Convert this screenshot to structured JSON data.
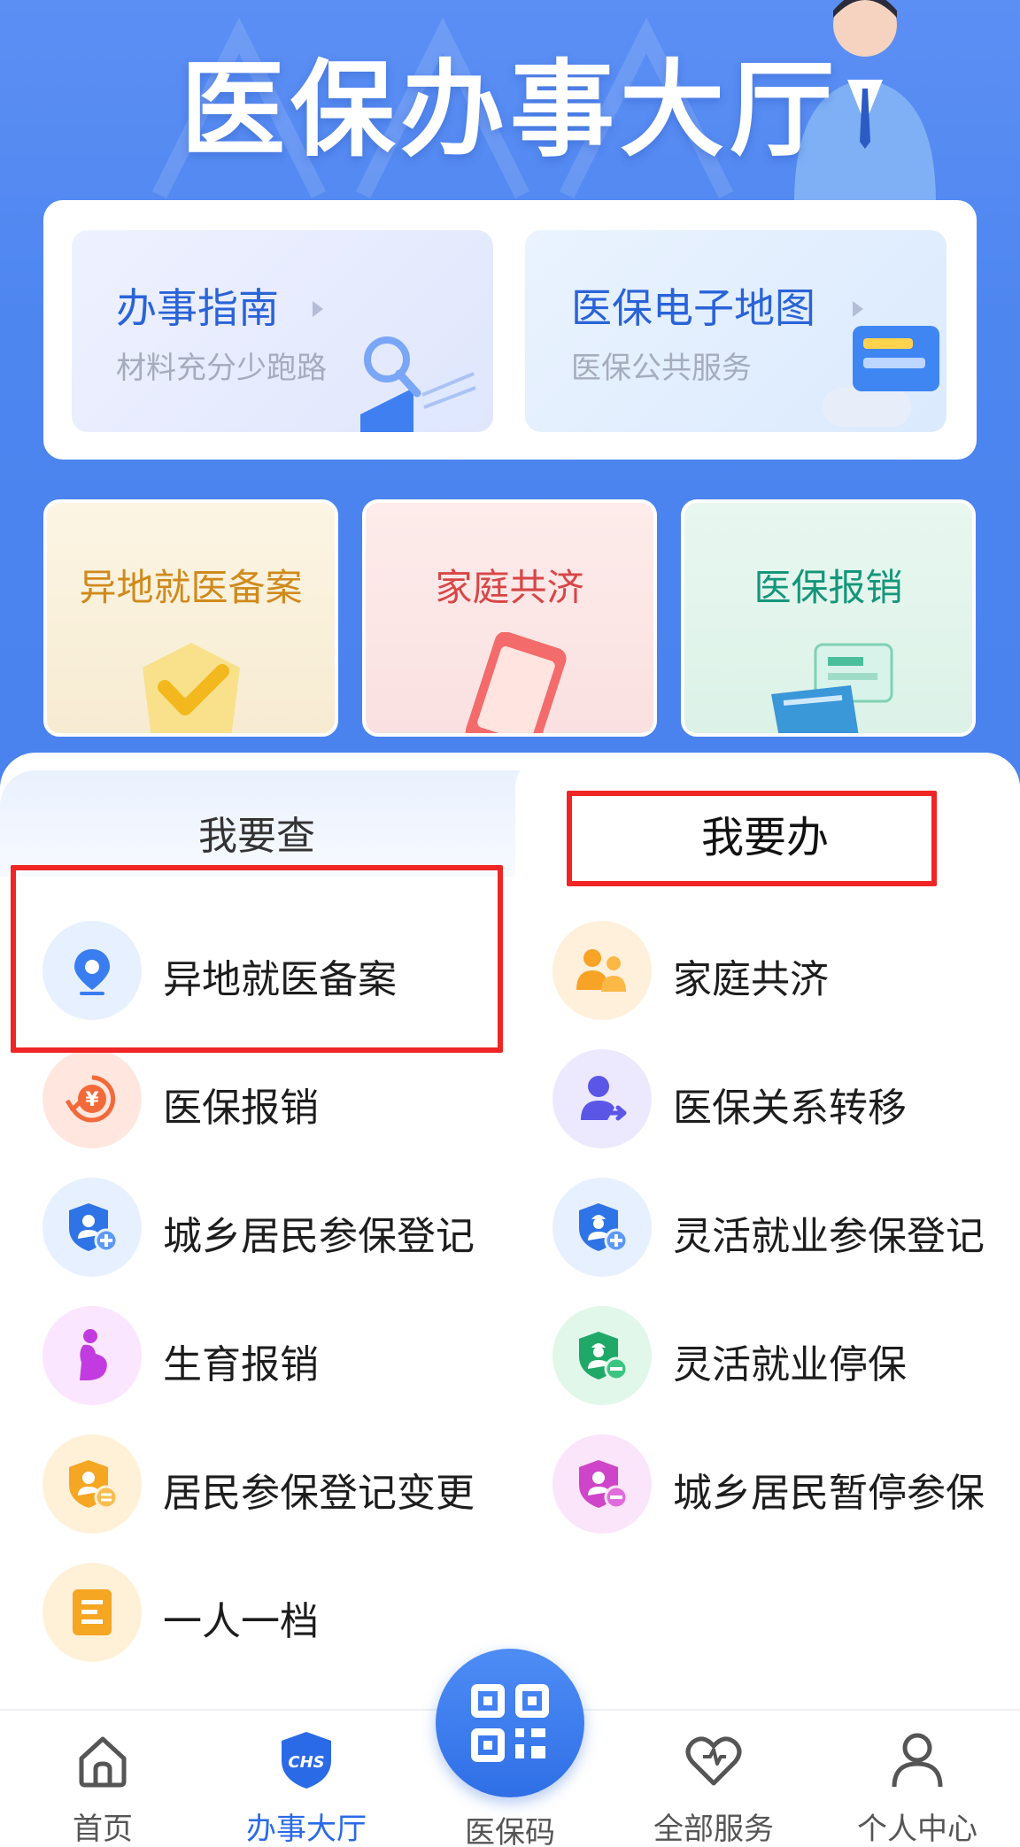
{
  "header": {
    "title": "医保办事大厅"
  },
  "top_card": {
    "guide": {
      "title": "办事指南",
      "subtitle": "材料充分少跑路"
    },
    "map": {
      "title": "医保电子地图",
      "subtitle": "医保公共服务"
    }
  },
  "quick_tiles": [
    {
      "label": "异地就医备案",
      "color": "#d08a1c"
    },
    {
      "label": "家庭共济",
      "color": "#d84646"
    },
    {
      "label": "医保报销",
      "color": "#14967a"
    }
  ],
  "tabs": {
    "query": "我要查",
    "handle": "我要办",
    "active": "handle"
  },
  "services": [
    {
      "label": "异地就医备案",
      "icon": "location-pin-icon"
    },
    {
      "label": "家庭共济",
      "icon": "family-icon"
    },
    {
      "label": "医保报销",
      "icon": "yuan-refund-icon"
    },
    {
      "label": "医保关系转移",
      "icon": "user-transfer-icon"
    },
    {
      "label": "城乡居民参保登记",
      "icon": "shield-user-add-icon"
    },
    {
      "label": "灵活就业参保登记",
      "icon": "shield-worker-add-icon"
    },
    {
      "label": "生育报销",
      "icon": "pregnant-icon"
    },
    {
      "label": "灵活就业停保",
      "icon": "shield-worker-minus-icon"
    },
    {
      "label": "居民参保登记变更",
      "icon": "shield-user-edit-icon"
    },
    {
      "label": "城乡居民暂停参保",
      "icon": "shield-user-minus-icon"
    },
    {
      "label": "一人一档",
      "icon": "file-record-icon"
    }
  ],
  "bottom_nav": {
    "home": "首页",
    "hall": "办事大厅",
    "code": "医保码",
    "all_services": "全部服务",
    "profile": "个人中心",
    "active": "hall"
  },
  "colors": {
    "accent": "#2a6ae6",
    "highlight": "#f02525",
    "header_bg": "#4e86f0"
  }
}
